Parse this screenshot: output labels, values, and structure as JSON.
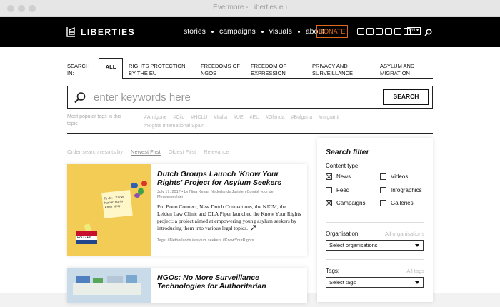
{
  "window": {
    "title": "Evermore - Liberties.eu"
  },
  "nav": {
    "logo_text": "LIBERTIES",
    "menu": [
      "stories",
      "campaigns",
      "visuals",
      "about"
    ],
    "donate": "DONATE",
    "lang": "EN ▾",
    "social_icons": [
      "facebook-icon",
      "twitter-icon",
      "instagram-icon",
      "youtube-icon",
      "linkedin-icon",
      "rss-icon"
    ]
  },
  "search": {
    "search_in_label": "SEARCH IN:",
    "tabs": [
      "ALL",
      "RIGHTS PROTECTION BY THE EU",
      "FREEDOMS OF NGOS",
      "FREEDOM OF EXPRESSION",
      "PRIVACY AND SURVEILLANCE",
      "ASYLUM AND MIGRATION"
    ],
    "active_tab": "ALL",
    "placeholder": "enter keywords here",
    "button": "SEARCH",
    "popular_label": "Most popular tags in this topic",
    "tags_line1": [
      "#Antigone",
      "#Cild",
      "#HCLU",
      "#Italia",
      "#UE",
      "#EU",
      "#Olanda",
      "#Bulgaria",
      "#migranti"
    ],
    "tags_line2": [
      "#Rights International Spain"
    ]
  },
  "order": {
    "label": "Order search results by",
    "options": [
      "Newest First",
      "Oldest First",
      "Relevance"
    ],
    "active": "Newest First"
  },
  "articles": [
    {
      "title": "Dutch Groups Launch 'Know Your Rights' Project for Asylum Seekers",
      "meta": "July 17, 2017 • by Nina Kesar, Nederlands Juristen Comité voor de Mensenrechten",
      "excerpt": "Pro Bono Connect, New Dutch Connections, the NJCM, the Leiden Law Clinic and DLA Piper launched the Know Your Rights project; a project aimed at empowering young asylum seekers by introducing them into various legal topics.",
      "tags": "Tags: #Netherlands #asylum seekers #KnowYourRights",
      "thumb_note": "To do: - Know human rights - Enter story",
      "thumb_flag": "HOLLAND"
    },
    {
      "title": "NGOs: No More Surveillance Technologies for Authoritarian"
    }
  ],
  "filter": {
    "title": "Search filter",
    "content_type_label": "Content type",
    "checkboxes": [
      {
        "label": "News",
        "checked": true
      },
      {
        "label": "Videos",
        "checked": false
      },
      {
        "label": "Feed",
        "checked": false
      },
      {
        "label": "Infographics",
        "checked": false
      },
      {
        "label": "Campaigns",
        "checked": true
      },
      {
        "label": "Galleries",
        "checked": false
      }
    ],
    "organisation_label": "Organisation:",
    "organisation_all": "All organisations",
    "organisation_select": "Select organisations",
    "tags_label": "Tags:",
    "tags_all": "All tags",
    "tags_select": "Select tags"
  }
}
